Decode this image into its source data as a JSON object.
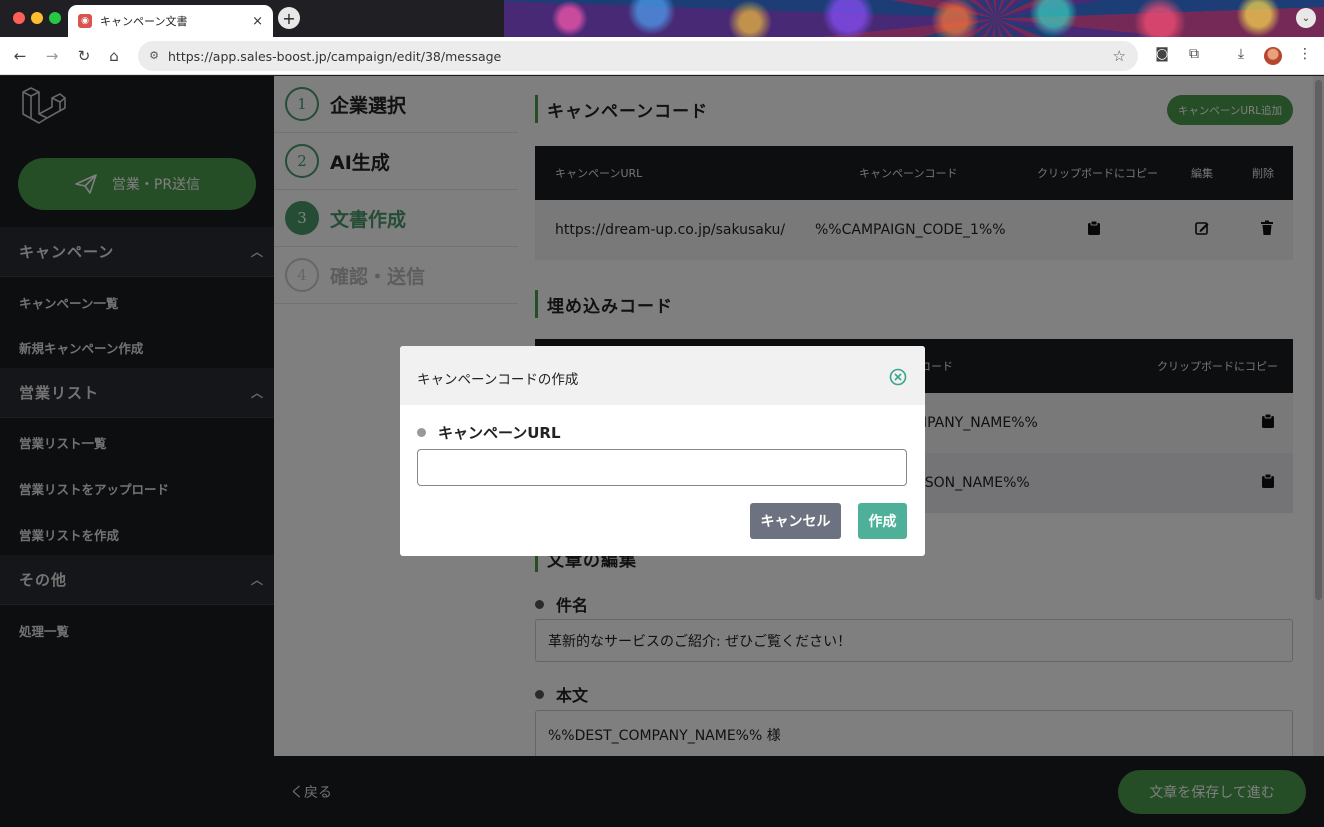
{
  "browser": {
    "tab_title": "キャンペーン文書",
    "tab_close": "×",
    "new_tab": "+",
    "tab_menu": "⌄",
    "url": "https://app.sales-boost.jp/campaign/edit/38/message"
  },
  "sidebar": {
    "send_button": "営業・PR送信",
    "sections": [
      {
        "title": "キャンペーン",
        "items": [
          "キャンペーン一覧",
          "新規キャンペーン作成"
        ]
      },
      {
        "title": "営業リスト",
        "items": [
          "営業リスト一覧",
          "営業リストをアップロード",
          "営業リストを作成"
        ]
      },
      {
        "title": "その他",
        "items": [
          "処理一覧"
        ]
      }
    ]
  },
  "steps": [
    {
      "num": "1",
      "label": "企業選択",
      "state": "done"
    },
    {
      "num": "2",
      "label": "AI生成",
      "state": "done"
    },
    {
      "num": "3",
      "label": "文書作成",
      "state": "active"
    },
    {
      "num": "4",
      "label": "確認・送信",
      "state": "disabled"
    }
  ],
  "campaign_code": {
    "title": "キャンペーンコード",
    "add_button": "キャンペーンURL追加",
    "headers": [
      "キャンペーンURL",
      "キャンペーンコード",
      "クリップボードにコピー",
      "編集",
      "削除"
    ],
    "rows": [
      {
        "url": "https://dream-up.co.jp/sakusaku/",
        "code": "%%CAMPAIGN_CODE_1%%"
      }
    ]
  },
  "embed_code": {
    "title": "埋め込みコード",
    "headers": [
      "コード",
      "クリップボードにコピー"
    ],
    "rows": [
      {
        "code": "MPANY_NAME%%"
      },
      {
        "code": "RSON_NAME%%"
      }
    ]
  },
  "editor": {
    "title": "文章の編集",
    "subject_label": "件名",
    "subject_value": "革新的なサービスのご紹介: ぜひご覧ください！",
    "body_label": "本文",
    "body_value": "%%DEST_COMPANY_NAME%% 様"
  },
  "footer": {
    "back": "く戻る",
    "save": "文章を保存して進む"
  },
  "modal": {
    "title": "キャンペーンコードの作成",
    "field_label": "キャンペーンURL",
    "field_value": "",
    "cancel": "キャンセル",
    "create": "作成"
  },
  "colors": {
    "accent_green": "#4a9b4d",
    "step_green": "#4a9b6d",
    "dark": "#1b1c20",
    "create_button": "#4fb09a",
    "cancel_button": "#6c7280"
  }
}
